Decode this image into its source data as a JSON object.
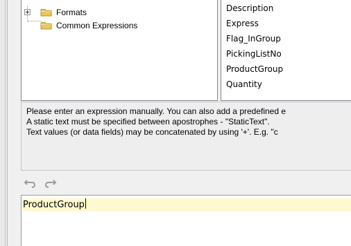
{
  "tree": {
    "items": [
      {
        "label": "Formats",
        "icon": "folder-icon",
        "expandable": true
      },
      {
        "label": "Common Expressions",
        "icon": "folder-icon",
        "expandable": false
      }
    ]
  },
  "fields": [
    "Description",
    "Express",
    "Flag_InGroup",
    "PickingListNo",
    "ProductGroup",
    "Quantity"
  ],
  "hint": {
    "lines": [
      "Please enter an expression manually. You can also add a predefined e",
      "A static text must be specified between apostrophes - \"StaticText\".",
      "Text values (or data fields) may be concatenated by using '+'. E.g. \"c"
    ]
  },
  "toolbar": {
    "undo_icon": "undo-icon",
    "redo_icon": "redo-icon"
  },
  "expression": {
    "value": "ProductGroup"
  },
  "colors": {
    "folder": "#e8c75f",
    "folder_outline": "#b7922e",
    "highlight": "#fff9cf"
  }
}
